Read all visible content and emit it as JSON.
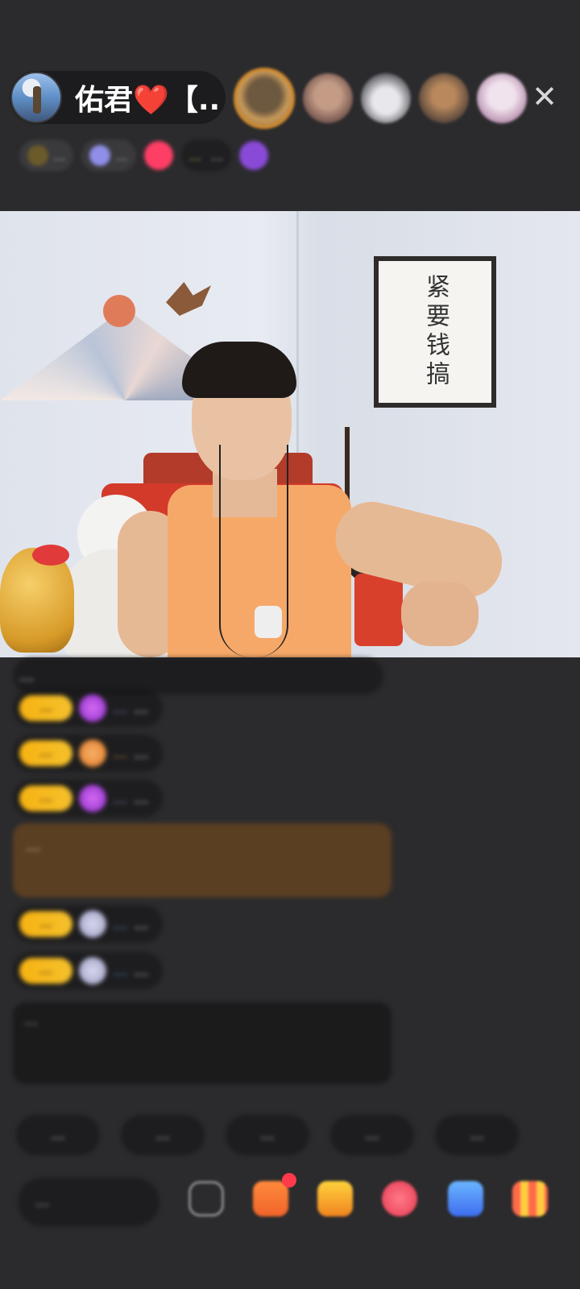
{
  "host": {
    "name": "佑君❤️【...",
    "avatar_icon": "host-avatar"
  },
  "header": {
    "close_label": "✕",
    "stats": {
      "chip1": "...",
      "chip2": "...",
      "chip3": "...",
      "chip4": "..."
    }
  },
  "video": {
    "calligraphy": "紧要钱搞"
  },
  "comments": {
    "c1_text": "...",
    "c2_level": "...",
    "c2_name": "...",
    "c2_text": "...",
    "c3_level": "...",
    "c3_name": "...",
    "c3_text": "...",
    "c4_level": "...",
    "c4_name": "...",
    "c4_text": "...",
    "c5_text": "...",
    "c6_level": "...",
    "c6_name": "...",
    "c6_text": "...",
    "c7_level": "...",
    "c7_name": "...",
    "c7_text": "...",
    "c8_text": "..."
  },
  "quick_replies": [
    "...",
    "...",
    "...",
    "...",
    "..."
  ],
  "bottom_bar": {
    "input_placeholder": "...",
    "icons": [
      "emoji-icon",
      "gift-icon",
      "treasure-box-icon",
      "heart-icon",
      "chat-icon",
      "more-grid-icon"
    ]
  },
  "colors": {
    "background": "#2b2b2d",
    "accent_level": "#f7b312",
    "system_message": "#9fd07a"
  }
}
